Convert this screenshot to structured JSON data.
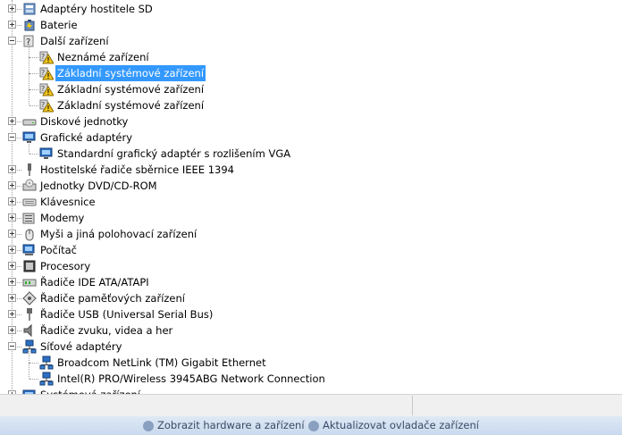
{
  "tree": {
    "items": [
      {
        "label": "Adaptéry hostitele SD",
        "icon": "sd-host-adapter-icon",
        "expanded": false
      },
      {
        "label": "Baterie",
        "icon": "battery-icon",
        "expanded": false
      },
      {
        "label": "Další zařízení",
        "icon": "other-devices-icon",
        "expanded": true,
        "children": [
          {
            "label": "Neznámé zařízení",
            "icon": "unknown-device-warning-icon"
          },
          {
            "label": "Základní systémové zařízení",
            "icon": "unknown-device-warning-icon",
            "selected": true
          },
          {
            "label": "Základní systémové zařízení",
            "icon": "unknown-device-warning-icon"
          },
          {
            "label": "Základní systémové zařízení",
            "icon": "unknown-device-warning-icon"
          }
        ]
      },
      {
        "label": "Diskové jednotky",
        "icon": "disk-drive-icon",
        "expanded": false
      },
      {
        "label": "Grafické adaptéry",
        "icon": "display-adapter-icon",
        "expanded": true,
        "children": [
          {
            "label": "Standardní grafický adaptér s rozlišením VGA",
            "icon": "display-adapter-icon"
          }
        ]
      },
      {
        "label": "Hostitelské řadiče sběrnice IEEE 1394",
        "icon": "ieee1394-icon",
        "expanded": false
      },
      {
        "label": "Jednotky DVD/CD-ROM",
        "icon": "dvd-drive-icon",
        "expanded": false
      },
      {
        "label": "Klávesnice",
        "icon": "keyboard-icon",
        "expanded": false
      },
      {
        "label": "Modemy",
        "icon": "modem-icon",
        "expanded": false
      },
      {
        "label": "Myši a jiná polohovací zařízení",
        "icon": "mouse-icon",
        "expanded": false
      },
      {
        "label": "Počítač",
        "icon": "computer-icon",
        "expanded": false
      },
      {
        "label": "Procesory",
        "icon": "processor-icon",
        "expanded": false
      },
      {
        "label": "Řadiče IDE ATA/ATAPI",
        "icon": "ide-controller-icon",
        "expanded": false
      },
      {
        "label": "Řadiče paměťových zařízení",
        "icon": "storage-controller-icon",
        "expanded": false
      },
      {
        "label": "Řadiče USB (Universal Serial Bus)",
        "icon": "usb-icon",
        "expanded": false
      },
      {
        "label": "Řadiče zvuku, videa a her",
        "icon": "speaker-icon",
        "expanded": false
      },
      {
        "label": "Síťové adaptéry",
        "icon": "network-adapter-icon",
        "expanded": true,
        "children": [
          {
            "label": "Broadcom NetLink (TM) Gigabit Ethernet",
            "icon": "network-adapter-icon"
          },
          {
            "label": "Intel(R) PRO/Wireless 3945ABG Network Connection",
            "icon": "network-adapter-icon"
          }
        ]
      },
      {
        "label": "Systémová zařízení",
        "icon": "system-devices-icon",
        "expanded": false
      }
    ]
  },
  "taskbar": {
    "items": [
      {
        "label": "Zobrazit hardware a zařízení",
        "icon": "hardware-icon"
      },
      {
        "label": "Aktualizovat ovladače zařízení",
        "icon": "update-driver-icon"
      }
    ]
  },
  "colors": {
    "selection": "#3399ff",
    "warning": "#f2c318",
    "statusbar": "#f0f0f0"
  }
}
